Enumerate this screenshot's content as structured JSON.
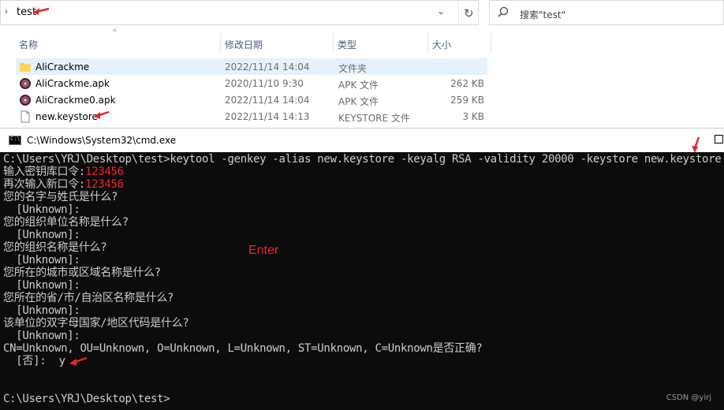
{
  "explorer": {
    "address": "test",
    "search_placeholder": "搜索\"test\"",
    "columns": [
      "名称",
      "修改日期",
      "类型",
      "大小"
    ],
    "files": [
      {
        "name": "AliCrackme",
        "date": "2022/11/14 14:04",
        "type": "文件夹",
        "size": "",
        "icon": "folder-icon",
        "selected": true
      },
      {
        "name": "AliCrackme.apk",
        "date": "2020/11/10 9:30",
        "type": "APK 文件",
        "size": "262 KB",
        "icon": "apk-icon",
        "selected": false
      },
      {
        "name": "AliCrackme0.apk",
        "date": "2022/11/14 14:04",
        "type": "APK 文件",
        "size": "259 KB",
        "icon": "apk-icon",
        "selected": false
      },
      {
        "name": "new.keystore",
        "date": "2022/11/14 14:13",
        "type": "KEYSTORE 文件",
        "size": "3 KB",
        "icon": "file-icon",
        "selected": false
      }
    ]
  },
  "cmd": {
    "title": "C:\\Windows\\System32\\cmd.exe",
    "icon_text": "C:\\",
    "lines": [
      "C:\\Users\\YRJ\\Desktop\\test>keytool -genkey -alias new.keystore -keyalg RSA -validity 20000 -keystore new.keystore",
      "输入密钥库口令:",
      "123456",
      "再次输入新口令:",
      "123456",
      "您的名字与姓氏是什么?",
      "  [Unknown]:",
      "您的组织单位名称是什么?",
      "  [Unknown]:",
      "您的组织名称是什么?",
      "  [Unknown]:",
      "您所在的城市或区域名称是什么?",
      "  [Unknown]:",
      "您所在的省/市/自治区名称是什么?",
      "  [Unknown]:",
      "该单位的双字母国家/地区代码是什么?",
      "  [Unknown]:",
      "CN=Unknown, OU=Unknown, O=Unknown, L=Unknown, ST=Unknown, C=Unknown是否正确?",
      "  [否]:  y",
      "C:\\Users\\YRJ\\Desktop\\test>"
    ],
    "annotation": "Enter",
    "watermark": "CSDN @yirj"
  },
  "colors": {
    "console_bg": "#0c0c0c",
    "console_text": "#cccccc",
    "annotation_red": "#e8242c",
    "selection": "#e5f1fb"
  }
}
